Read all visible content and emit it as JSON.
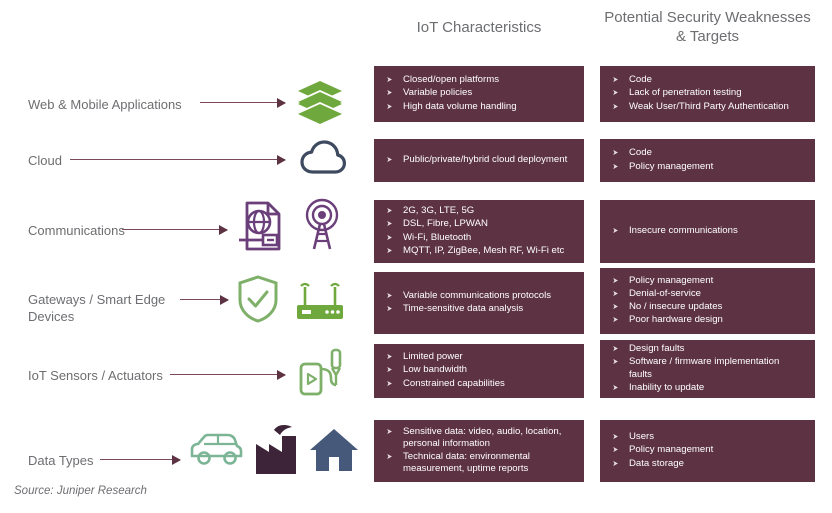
{
  "headers": {
    "characteristics": "IoT Characteristics",
    "security": "Potential Security\nWeaknesses & Targets"
  },
  "source": "Source: Juniper Research",
  "colors": {
    "box_fill": "#5d3343",
    "arrow": "#7b4a58",
    "label_text": "#6d6e71",
    "green": "#6fa83c",
    "green_soft": "#7fb069",
    "teal_green": "#7cb496",
    "navy": "#3e4a60",
    "purple": "#6b3f7a",
    "dark_purple": "#3e2438",
    "house_blue": "#46597a"
  },
  "rows": [
    {
      "label": "Web & Mobile Applications",
      "icons": [
        "layers-stack-icon"
      ],
      "characteristics": [
        "Closed/open platforms",
        "Variable policies",
        "High data volume handling"
      ],
      "weaknesses": [
        "Code",
        "Lack of penetration testing",
        "Weak User/Third Party Authentication"
      ]
    },
    {
      "label": "Cloud",
      "icons": [
        "cloud-icon"
      ],
      "characteristics": [
        "Public/private/hybrid cloud deployment"
      ],
      "weaknesses": [
        "Code",
        "Policy management"
      ]
    },
    {
      "label": "Communications",
      "icons": [
        "globe-document-icon",
        "radio-tower-icon"
      ],
      "characteristics": [
        "2G, 3G, LTE, 5G",
        "DSL, Fibre, LPWAN",
        "Wi-Fi, Bluetooth",
        "MQTT, IP, ZigBee, Mesh RF, Wi-Fi etc"
      ],
      "weaknesses": [
        "Insecure communications"
      ]
    },
    {
      "label": "Gateways / Smart Edge\nDevices",
      "icons": [
        "shield-check-icon",
        "router-icon"
      ],
      "characteristics": [
        "Variable communications protocols",
        "Time-sensitive data analysis"
      ],
      "weaknesses": [
        "Policy management",
        "Denial-of-service",
        "No / insecure updates",
        "Poor hardware design"
      ]
    },
    {
      "label": "IoT Sensors / Actuators",
      "icons": [
        "sensor-actuator-icon"
      ],
      "characteristics": [
        "Limited power",
        "Low bandwidth",
        "Constrained capabilities"
      ],
      "weaknesses": [
        "Design faults",
        "Software / firmware implementation\nfaults",
        "Inability to update"
      ]
    },
    {
      "label": "Data Types",
      "icons": [
        "car-icon",
        "factory-icon",
        "house-icon"
      ],
      "characteristics": [
        "Sensitive data: video, audio, location,\npersonal information",
        "Technical data: environmental\nmeasurement, uptime reports"
      ],
      "weaknesses": [
        "Users",
        "Policy management",
        "Data storage"
      ]
    }
  ]
}
